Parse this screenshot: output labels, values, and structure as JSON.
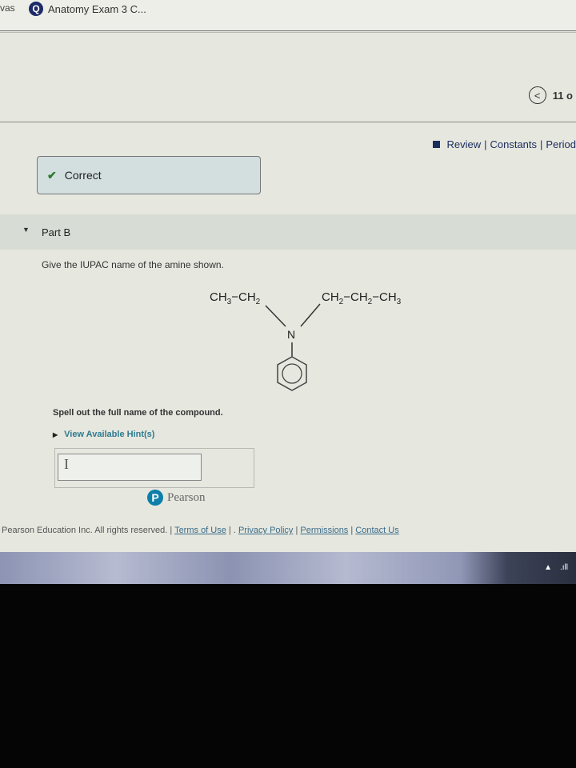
{
  "browser": {
    "prev_tab_fragment": "vas",
    "active_tab": {
      "icon": "quiz-q-icon",
      "icon_glyph": "Q",
      "title": "Anatomy Exam 3 C..."
    }
  },
  "nav": {
    "back_glyph": "<",
    "page_count": "11 o"
  },
  "links": {
    "review": "Review",
    "constants": "Constants",
    "periodic": "Period",
    "separator": "|"
  },
  "part_a_status": {
    "icon_glyph": "✔",
    "label": "Correct",
    "accent": "#2a7a2a"
  },
  "part_b": {
    "caret": "▼",
    "label": "Part B",
    "question": "Give the IUPAC name of the amine shown.",
    "molecule": {
      "left_chain": "CH3−CH2",
      "right_chain": "CH2−CH2−CH3",
      "center_atom": "N",
      "substituent": "benzene-ring"
    },
    "instruction": "Spell out the full name of the compound.",
    "hint_label": "View Available Hint(s)",
    "answer_value": "",
    "answer_placeholder": ""
  },
  "brand": {
    "logo_glyph": "P",
    "name": "Pearson",
    "color": "#0e7fa8"
  },
  "footer": {
    "copyright": "Pearson Education Inc. All rights reserved.",
    "links": [
      "Terms of Use",
      "Privacy Policy",
      "Permissions",
      "Contact Us"
    ]
  },
  "taskbar": {
    "tray_icons": [
      "tray-arrow-up-icon",
      "signal-bars-icon"
    ],
    "arrow_glyph": "▲",
    "signal_glyph": ".ıll"
  }
}
